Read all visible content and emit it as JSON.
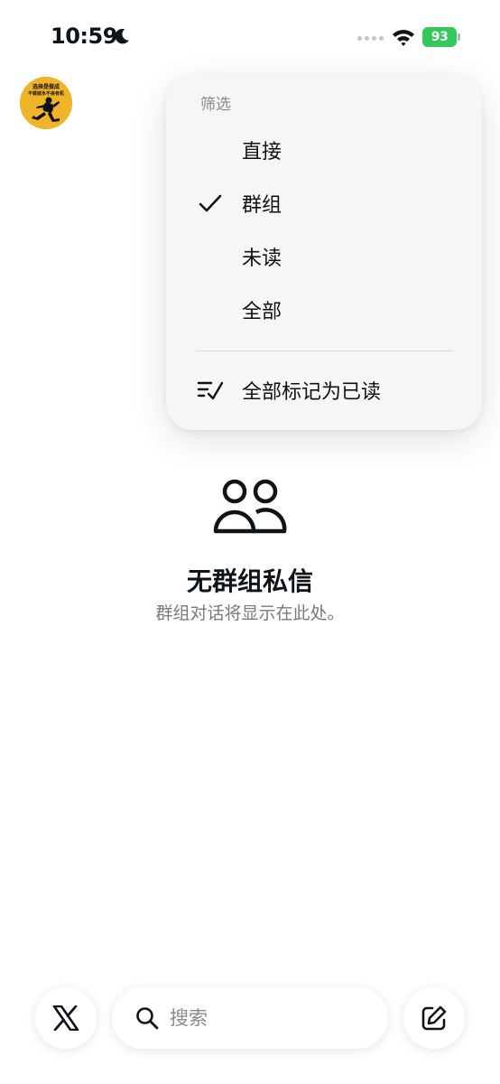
{
  "status_bar": {
    "time": "10:59",
    "battery": "93"
  },
  "avatar": {
    "caption_line1": "选择是做成",
    "caption_line2": "不做就永不会有机"
  },
  "filter_menu": {
    "title": "筛选",
    "items": [
      {
        "label": "直接",
        "checked": false
      },
      {
        "label": "群组",
        "checked": true
      },
      {
        "label": "未读",
        "checked": false
      },
      {
        "label": "全部",
        "checked": false
      }
    ],
    "mark_all_read": "全部标记为已读"
  },
  "empty_state": {
    "icon": "people-icon",
    "title": "无群组私信",
    "subtitle": "群组对话将显示在此处。"
  },
  "bottom_bar": {
    "home_icon": "x-logo-icon",
    "search_placeholder": "搜索",
    "compose_icon": "compose-icon"
  },
  "colors": {
    "battery": "#34c759",
    "avatar_bg": "#f0b429",
    "secondary_text": "#7a7a7a"
  }
}
